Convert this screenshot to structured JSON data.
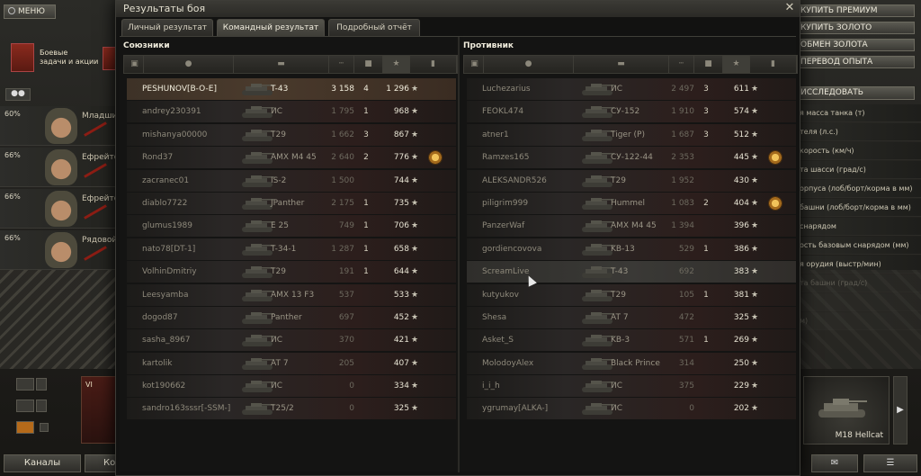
{
  "app": {
    "menu_label": "МЕНЮ",
    "missions_label_1": "Боевые",
    "missions_label_2": "задачи и акции",
    "channels_label": "Каналы",
    "channels2_label": "Кон"
  },
  "crew": [
    {
      "pct": "60%",
      "rank": "Младши"
    },
    {
      "pct": "66%",
      "rank": "Ефрейто"
    },
    {
      "pct": "66%",
      "rank": "Ефрейто"
    },
    {
      "pct": "66%",
      "rank": "Рядовой"
    }
  ],
  "tank_card_left": {
    "tier": "VI"
  },
  "right_panel": {
    "buttons": [
      "КУПИТЬ ПРЕМИУМ",
      "КУПИТЬ ЗОЛОТО",
      "ОБМЕН ЗОЛОТА",
      "ПЕРЕВОД ОПЫТА"
    ],
    "research_label": "ИССЛЕДОВАТЬ",
    "params": [
      "я масса танка (т)",
      "теля (л.с.)",
      "корость (км/ч)",
      "та шасси (град/с)",
      "орпуса (лоб/борт/корма в мм)",
      "башни (лоб/борт/корма в мм)",
      "снарядом",
      "ость базовым снарядом (мм)",
      "я орудия (выстр/мин)",
      "та башни (град/с)",
      "",
      "м)"
    ],
    "selected_tank": "M18 Hellcat"
  },
  "dialog": {
    "title": "Результаты боя",
    "close_icon": "close-icon",
    "tabs": [
      "Личный результат",
      "Командный результат",
      "Подробный отчёт"
    ],
    "active_tab": 1
  },
  "allies": {
    "title": "Союзники",
    "rows": [
      {
        "name": "PESHUNOV[B-O-E]",
        "tank": "T-43",
        "dmg": "3 158",
        "frags": "4",
        "xp": "1 296",
        "self": true
      },
      {
        "name": "andrey230391",
        "tank": "ИС",
        "dmg": "1 795",
        "frags": "1",
        "xp": "968"
      },
      {
        "name": "mishanya00000",
        "tank": "T29",
        "dmg": "1 662",
        "frags": "3",
        "xp": "867"
      },
      {
        "name": "Rond37",
        "tank": "AMX M4 45",
        "dmg": "2 640",
        "frags": "2",
        "xp": "776",
        "medal": true
      },
      {
        "name": "zacranec01",
        "tank": "IS-2",
        "dmg": "1 500",
        "frags": "",
        "xp": "744"
      },
      {
        "name": "diablo7722",
        "tank": "JPanther",
        "dmg": "2 175",
        "frags": "1",
        "xp": "735"
      },
      {
        "name": "glumus1989",
        "tank": "E 25",
        "dmg": "749",
        "frags": "1",
        "xp": "706"
      },
      {
        "name": "nato78[DT-1]",
        "tank": "T-34-1",
        "dmg": "1 287",
        "frags": "1",
        "xp": "658"
      },
      {
        "name": "VolhinDmitriy",
        "tank": "T29",
        "dmg": "191",
        "frags": "1",
        "xp": "644"
      },
      {
        "name": "Leesyamba",
        "tank": "AMX 13 F3",
        "dmg": "537",
        "frags": "",
        "xp": "533"
      },
      {
        "name": "dogod87",
        "tank": "Panther",
        "dmg": "697",
        "frags": "",
        "xp": "452"
      },
      {
        "name": "sasha_8967",
        "tank": "ИС",
        "dmg": "370",
        "frags": "",
        "xp": "421"
      },
      {
        "name": "kartolik",
        "tank": "AT 7",
        "dmg": "205",
        "frags": "",
        "xp": "407"
      },
      {
        "name": "kot190662",
        "tank": "ИС",
        "dmg": "0",
        "frags": "",
        "xp": "334"
      },
      {
        "name": "sandro163sssr[-SSM-]",
        "tank": "T25/2",
        "dmg": "0",
        "frags": "",
        "xp": "325"
      }
    ]
  },
  "enemies": {
    "title": "Противник",
    "rows": [
      {
        "name": "Luchezarius",
        "tank": "ИС",
        "dmg": "2 497",
        "frags": "3",
        "xp": "611"
      },
      {
        "name": "FEOKL474",
        "tank": "СУ-152",
        "dmg": "1 910",
        "frags": "3",
        "xp": "574"
      },
      {
        "name": "atner1",
        "tank": "Tiger (P)",
        "dmg": "1 687",
        "frags": "3",
        "xp": "512"
      },
      {
        "name": "Ramzes165",
        "tank": "СУ-122-44",
        "dmg": "2 353",
        "frags": "",
        "xp": "445",
        "medal": true
      },
      {
        "name": "ALEKSANDR526",
        "tank": "T29",
        "dmg": "1 952",
        "frags": "",
        "xp": "430"
      },
      {
        "name": "piligrim999",
        "tank": "Hummel",
        "dmg": "1 083",
        "frags": "2",
        "xp": "404",
        "medal": true
      },
      {
        "name": "PanzerWaf",
        "tank": "AMX M4 45",
        "dmg": "1 394",
        "frags": "",
        "xp": "396"
      },
      {
        "name": "gordiencovova",
        "tank": "KB-13",
        "dmg": "529",
        "frags": "1",
        "xp": "386"
      },
      {
        "name": "ScreamLive",
        "tank": "T-43",
        "dmg": "692",
        "frags": "",
        "xp": "383",
        "hover": true
      },
      {
        "name": "kutyukov",
        "tank": "T29",
        "dmg": "105",
        "frags": "1",
        "xp": "381"
      },
      {
        "name": "Shesa",
        "tank": "AT 7",
        "dmg": "472",
        "frags": "",
        "xp": "325"
      },
      {
        "name": "Asket_S",
        "tank": "KB-3",
        "dmg": "571",
        "frags": "1",
        "xp": "269"
      },
      {
        "name": "MolodoyAlex",
        "tank": "Black Prince",
        "dmg": "314",
        "frags": "",
        "xp": "250"
      },
      {
        "name": "i_i_h",
        "tank": "ИС",
        "dmg": "375",
        "frags": "",
        "xp": "229"
      },
      {
        "name": "ygrumay[ALKA-]",
        "tank": "ИС",
        "dmg": "0",
        "frags": "",
        "xp": "202"
      }
    ]
  },
  "columns": [
    {
      "name": "squad-icon",
      "sorted": false
    },
    {
      "name": "player-icon",
      "sorted": false
    },
    {
      "name": "tank-icon",
      "sorted": false
    },
    {
      "name": "damage-icon",
      "sorted": false
    },
    {
      "name": "frags-icon",
      "sorted": false
    },
    {
      "name": "xp-star-icon",
      "sorted": true
    },
    {
      "name": "status-icon",
      "sorted": false
    }
  ],
  "colors": {
    "accent": "#f2eedd",
    "self_row": "#4a3a2c",
    "medal": "#f1c35a"
  }
}
